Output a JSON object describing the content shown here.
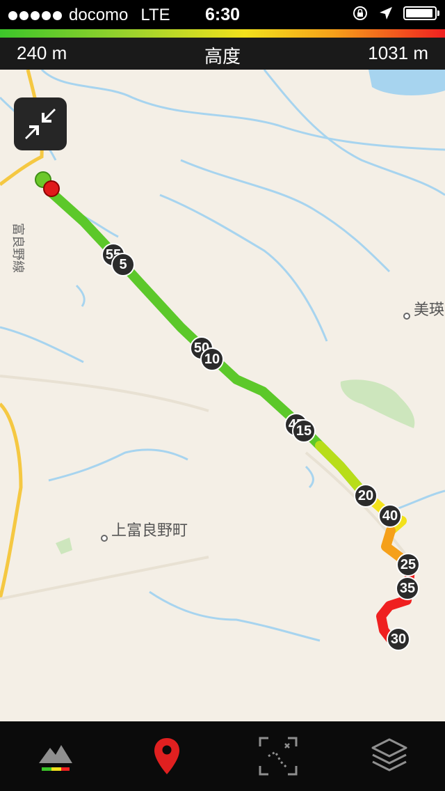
{
  "status_bar": {
    "carrier": "docomo",
    "network": "LTE",
    "time": "6:30"
  },
  "altitude": {
    "min": "240 m",
    "label": "高度",
    "max": "1031 m"
  },
  "route": {
    "gradient_colors": [
      "#3cc52a",
      "#9ed22c",
      "#f2e11c",
      "#f5a01a",
      "#ef2020"
    ],
    "km_markers": [
      "55",
      "5",
      "50",
      "10",
      "45",
      "15",
      "20",
      "40",
      "25",
      "35",
      "30"
    ]
  },
  "map_labels": {
    "line_name": "富良野線",
    "place_1": "美瑛",
    "place_2": "上富良野町"
  },
  "tabs": [
    {
      "icon": "mountain-icon"
    },
    {
      "icon": "map-pin-icon"
    },
    {
      "icon": "fit-route-icon"
    },
    {
      "icon": "layers-icon"
    }
  ]
}
